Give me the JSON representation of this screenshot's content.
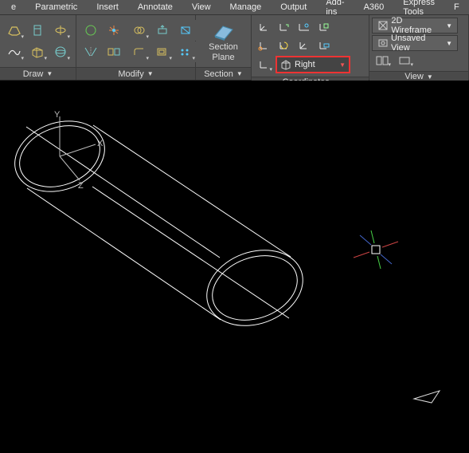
{
  "tabs": {
    "t0": "e",
    "t1": "Parametric",
    "t2": "Insert",
    "t3": "Annotate",
    "t4": "View",
    "t5": "Manage",
    "t6": "Output",
    "t7": "Add-ins",
    "t8": "A360",
    "t9": "Express Tools",
    "t10": "F"
  },
  "panels": {
    "draw": "Draw",
    "modify": "Modify",
    "section": "Section",
    "coords": "Coordinates",
    "view": "View"
  },
  "section_big": "Section\nPlane",
  "coords_named": "Right",
  "view_style": "2D Wireframe",
  "view_named": "Unsaved View",
  "axes": {
    "x": "X",
    "y": "Y",
    "z": "Z"
  }
}
